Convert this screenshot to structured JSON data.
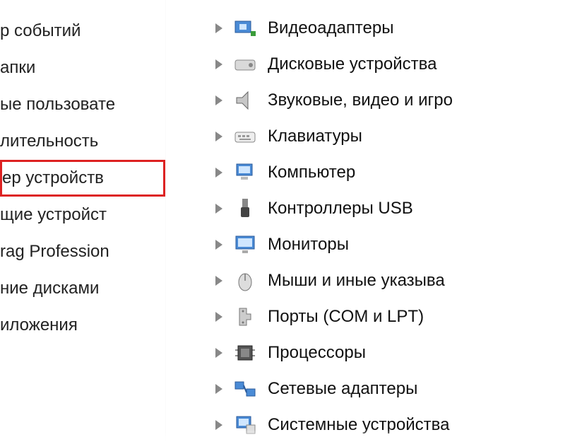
{
  "left_panel": {
    "items": [
      {
        "label": "р событий",
        "highlighted": false
      },
      {
        "label": "апки",
        "highlighted": false
      },
      {
        "label": "ые пользовате",
        "highlighted": false
      },
      {
        "label": "лительность",
        "highlighted": false
      },
      {
        "label": "ер устройств",
        "highlighted": true
      },
      {
        "label": "щие устройст",
        "highlighted": false
      },
      {
        "label": "rag Profession",
        "highlighted": false
      },
      {
        "label": "ние дисками",
        "highlighted": false
      },
      {
        "label": "иложения",
        "highlighted": false
      }
    ]
  },
  "device_tree": {
    "nodes": [
      {
        "label": "Видеоадаптеры",
        "icon": "display-adapter-icon"
      },
      {
        "label": "Дисковые устройства",
        "icon": "disk-icon"
      },
      {
        "label": "Звуковые, видео и игро",
        "icon": "speaker-icon"
      },
      {
        "label": "Клавиатуры",
        "icon": "keyboard-icon"
      },
      {
        "label": "Компьютер",
        "icon": "computer-icon"
      },
      {
        "label": "Контроллеры USB",
        "icon": "usb-icon"
      },
      {
        "label": "Мониторы",
        "icon": "monitor-icon"
      },
      {
        "label": "Мыши и иные указыва",
        "icon": "mouse-icon"
      },
      {
        "label": "Порты (COM и LPT)",
        "icon": "port-icon"
      },
      {
        "label": "Процессоры",
        "icon": "cpu-icon"
      },
      {
        "label": "Сетевые адаптеры",
        "icon": "network-icon"
      },
      {
        "label": "Системные устройства",
        "icon": "system-icon"
      }
    ]
  }
}
